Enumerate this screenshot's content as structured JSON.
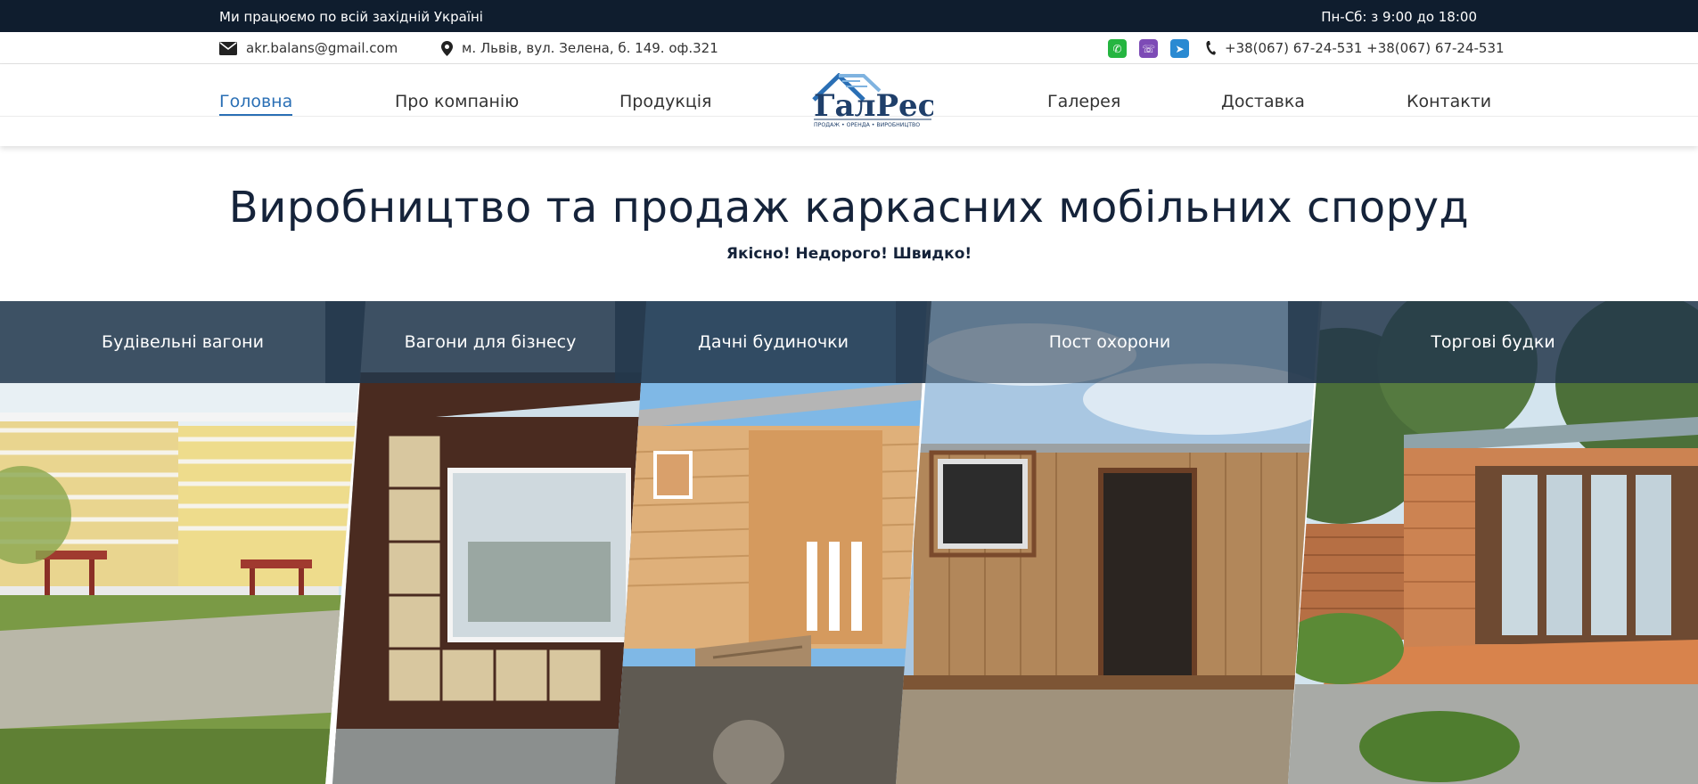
{
  "topbar": {
    "region_text": "Ми працюємо по всій західній Україні",
    "hours_text": "Пн-Сб: з 9:00 до 18:00"
  },
  "contacts": {
    "email": "akr.balans@gmail.com",
    "address": "м. Львів, вул. Зелена, б. 149. оф.321",
    "phones": "+38(067) 67-24-531 +38(067) 67-24-531",
    "icons": [
      "envelope-icon",
      "map-pin-icon",
      "whatsapp-icon",
      "viber-icon",
      "telegram-icon",
      "phone-icon"
    ]
  },
  "nav": {
    "items": [
      {
        "label": "Головна",
        "active": true
      },
      {
        "label": "Про компанію"
      },
      {
        "label": "Продукція"
      },
      {
        "label": "Галерея"
      },
      {
        "label": "Доставка"
      },
      {
        "label": "Контакти"
      }
    ],
    "logo": {
      "name": "ГалРес",
      "tagline": "ПРОДАЖ • ОРЕНДА • ВИРОБНИЦТВО"
    }
  },
  "hero": {
    "title": "Виробництво та продаж каркасних мобільних споруд",
    "subtitle": "Якісно! Недорого! Швидко!"
  },
  "gallery": {
    "items": [
      {
        "label": "Будівельні вагони"
      },
      {
        "label": "Вагони для бізнесу"
      },
      {
        "label": "Дачні будиночки"
      },
      {
        "label": "Пост охорони"
      },
      {
        "label": "Торгові будки"
      }
    ]
  },
  "colors": {
    "topbar_bg": "#0f1d2e",
    "accent": "#2a6fb5",
    "label_overlay": "rgba(35,55,75,0.85)"
  }
}
